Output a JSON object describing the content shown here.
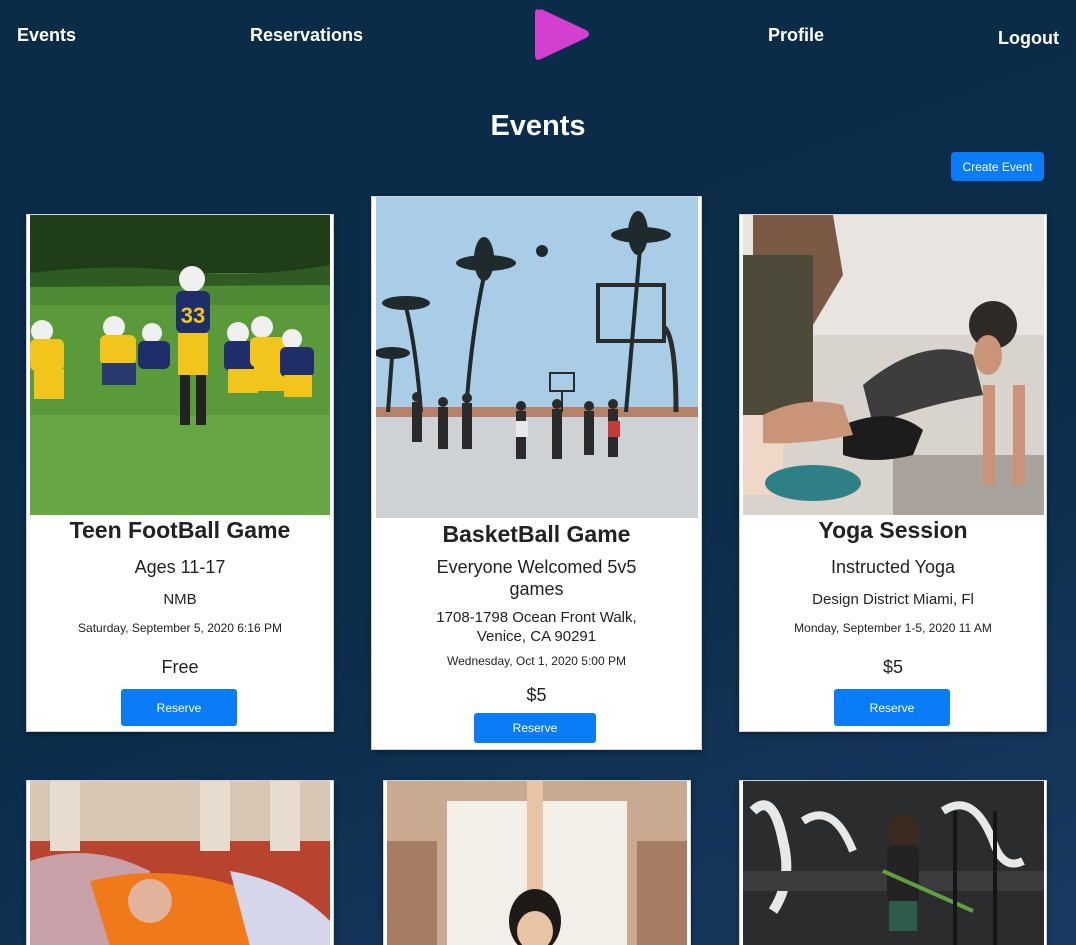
{
  "nav": {
    "events_label": "Events",
    "reservations_label": "Reservations",
    "profile_label": "Profile",
    "logout_label": "Logout",
    "logo_icon": "play-triangle-icon",
    "logo_color": "#d340d0"
  },
  "page": {
    "title": "Events",
    "create_event_label": "Create Event"
  },
  "events": [
    {
      "title": "Teen FootBall Game",
      "subtitle": "Ages 11-17",
      "location": "NMB",
      "date": "Saturday, September 5, 2020 6:16 PM",
      "price": "Free",
      "reserve_label": "Reserve",
      "image": "youth-football-photo"
    },
    {
      "title": "BasketBall Game",
      "subtitle": "Everyone Welcomed 5v5 games",
      "location": "1708-1798 Ocean Front Walk, Venice, CA 90291",
      "date": "Wednesday, Oct 1, 2020 5:00 PM",
      "price": "$5",
      "reserve_label": "Reserve",
      "image": "beach-basketball-photo"
    },
    {
      "title": "Yoga Session",
      "subtitle": "Instructed Yoga",
      "location": "Design District Miami, Fl",
      "date": "Monday, September 1-5, 2020 11 AM",
      "price": "$5",
      "reserve_label": "Reserve",
      "image": "yoga-instruction-photo"
    },
    {
      "image": "group-stretch-photo"
    },
    {
      "image": "woman-stretch-photo"
    },
    {
      "image": "gym-rebuild-photo"
    }
  ],
  "colors": {
    "accent": "#0a7cf8",
    "background": "#0b2c47"
  }
}
